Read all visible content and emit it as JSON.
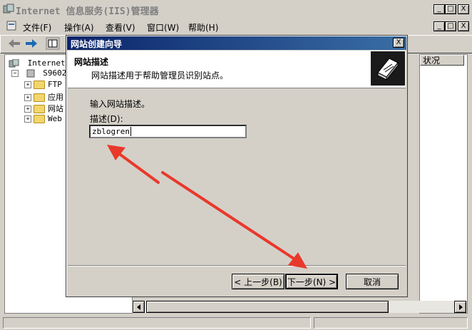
{
  "app": {
    "title": "Internet 信息服务(IIS)管理器",
    "caption_minimize": "_",
    "caption_maximize": "□",
    "caption_close": "X"
  },
  "menu": {
    "items": [
      {
        "label": "文件(F)"
      },
      {
        "label": "操作(A)"
      },
      {
        "label": "查看(V)"
      },
      {
        "label": "窗口(W)"
      },
      {
        "label": "帮助(H)"
      }
    ]
  },
  "tree": {
    "root": "Internet 信",
    "server": "S960277",
    "children": [
      "FTP",
      "应用",
      "网站",
      "Web"
    ]
  },
  "rightpane": {
    "column_header": "状况"
  },
  "dialog": {
    "title": "网站创建向导",
    "header_title": "网站描述",
    "header_subtitle": "网站描述用于帮助管理员识别站点。",
    "instruction": "输入网站描述。",
    "field_label": "描述(D):",
    "field_value": "zblogren",
    "back_label": "< 上一步(B)",
    "next_label": "下一步(N) >",
    "cancel_label": "取消"
  },
  "colors": {
    "title_gradient_start": "#0a246a",
    "title_gradient_end": "#3a6ea5",
    "annotation_arrow": "#e8392b",
    "window_bg": "#d4d0c8"
  }
}
